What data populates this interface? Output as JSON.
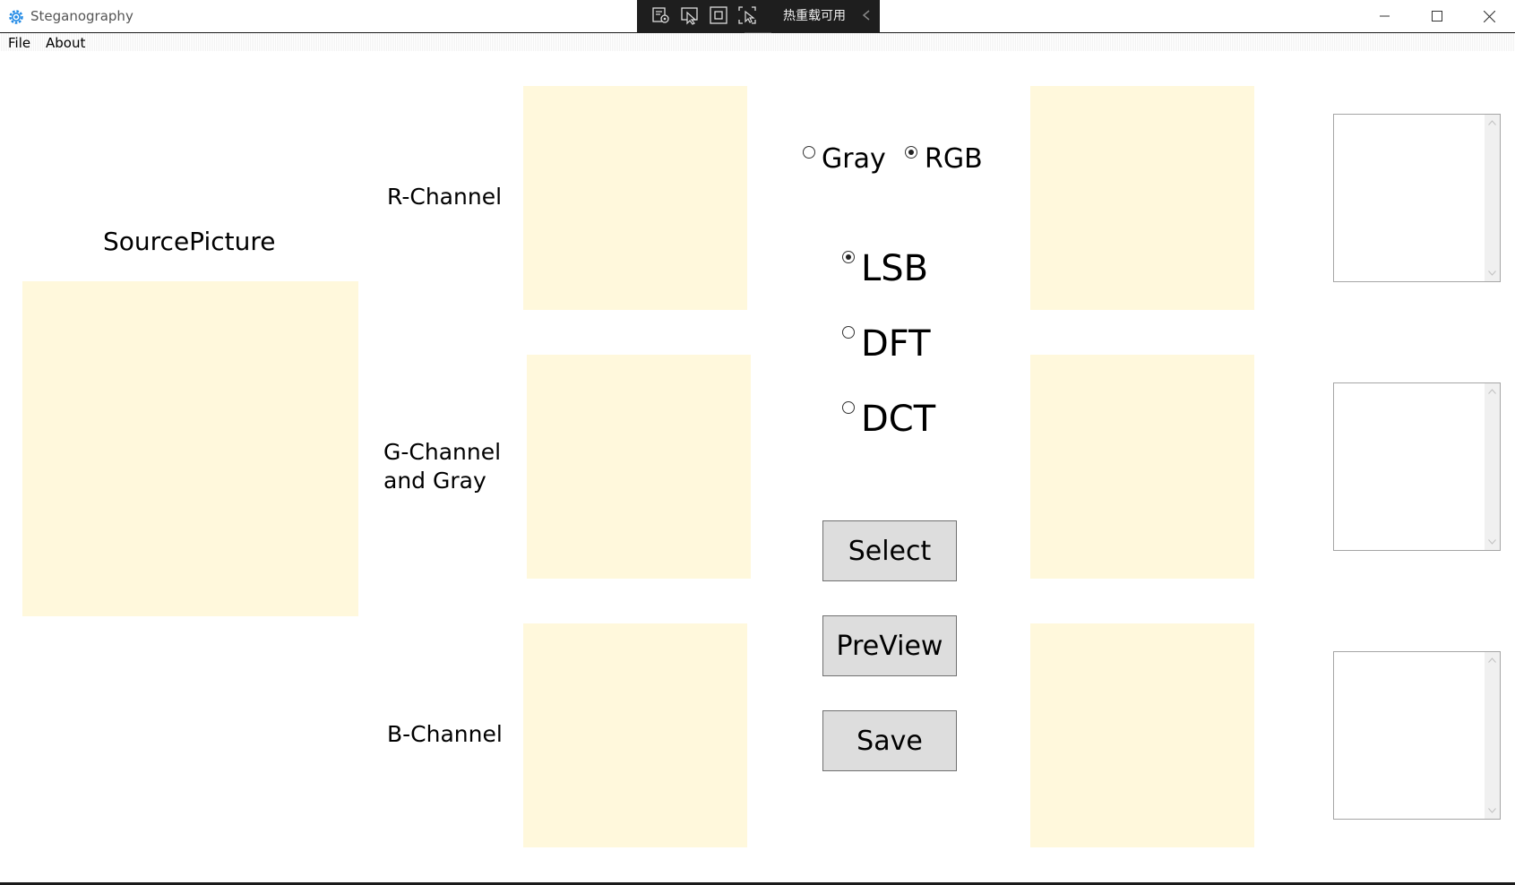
{
  "window": {
    "title": "Steganography",
    "icon": "gear-icon",
    "controls": [
      "minimize-icon",
      "maximize-icon",
      "close-icon"
    ]
  },
  "debug_toolbar": {
    "hot_reload_text": "热重载可用",
    "icons": [
      "live-visual-tree-icon",
      "select-element-icon",
      "display-layout-adorners-icon",
      "track-focus-icon",
      "collapse-chevron-icon"
    ]
  },
  "menu": {
    "file": "File",
    "about": "About"
  },
  "source": {
    "label": "SourcePicture"
  },
  "channels": {
    "r_label": "R-Channel",
    "g_label_line1": "G-Channel",
    "g_label_line2": "and Gray",
    "b_label": "B-Channel"
  },
  "color_mode": {
    "options": [
      {
        "label": "Gray",
        "checked": false
      },
      {
        "label": "RGB",
        "checked": true
      }
    ]
  },
  "algorithm": {
    "options": [
      {
        "label": "LSB",
        "checked": true
      },
      {
        "label": "DFT",
        "checked": false
      },
      {
        "label": "DCT",
        "checked": false
      }
    ]
  },
  "buttons": {
    "select": "Select",
    "preview": "PreView",
    "save": "Save"
  },
  "colors": {
    "image_placeholder": "#fff8dc",
    "button_bg": "#dddddd",
    "debug_toolbar_bg": "#1e1e1e",
    "accent": "#1e88e5"
  }
}
